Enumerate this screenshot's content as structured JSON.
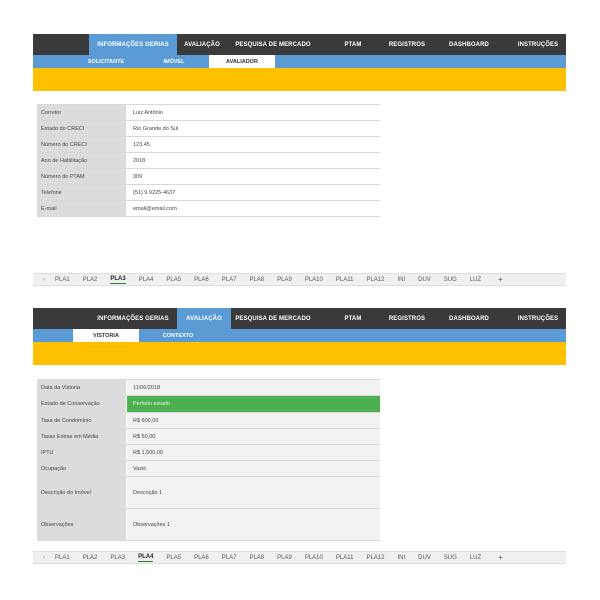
{
  "panel1": {
    "nav_tabs": [
      "INFORMAÇÕES GERIAS",
      "AVALIAÇÃO",
      "PESQUISA DE MERCADO",
      "PTAM",
      "REGISTROS",
      "DASHBOARD",
      "INSTRUÇÕES"
    ],
    "active_nav": 0,
    "sub_tabs": [
      "SOLICITANTE",
      "IMÓVEL",
      "AVALIADOR"
    ],
    "active_sub": 2,
    "rows": [
      {
        "label": "Corretor",
        "value": "Luiz Antônio"
      },
      {
        "label": "Estado do CRECI",
        "value": "Rio Grande do Sul"
      },
      {
        "label": "Número do CRECI",
        "value": "123.45"
      },
      {
        "label": "Ano de Habilitação",
        "value": "2018"
      },
      {
        "label": "Número do PTAM",
        "value": "309"
      },
      {
        "label": "Telefone",
        "value": "(51) 9 9225-4637"
      },
      {
        "label": "E-mail",
        "value": "email@email.com"
      }
    ]
  },
  "panel2": {
    "nav_tabs": [
      "INFORMAÇÕES GERIAS",
      "AVALIAÇÃO",
      "PESQUISA DE MERCADO",
      "PTAM",
      "REGISTROS",
      "DASHBOARD",
      "INSTRUÇÕES"
    ],
    "active_nav": 1,
    "sub_tabs": [
      "VISTORIA",
      "CONTEXTO"
    ],
    "active_sub": 0,
    "rows": [
      {
        "label": "Data da Vistoria",
        "value": "11/06/2018"
      },
      {
        "label": "Estado de Conservação",
        "value": "Perfeito estado"
      },
      {
        "label": "Taxa de Condomínio",
        "value": "R$ 600,00"
      },
      {
        "label": "Taxas Extras em Média",
        "value": "R$ 50,00"
      },
      {
        "label": "IPTU",
        "value": "R$ 1.500,00"
      },
      {
        "label": "Ocupação",
        "value": "Vazio"
      },
      {
        "label": "Descrição do Imóvel",
        "value": "Descrição 1"
      },
      {
        "label": "Observações",
        "value": "Observações 1"
      }
    ]
  },
  "sheets1": {
    "prev_arrow": "‹",
    "tabs": [
      "PLA1",
      "PLA2",
      "PLA3",
      "PLA4",
      "PLA5",
      "PLA6",
      "PLA7",
      "PLA8",
      "PLA9",
      "PLA10",
      "PLA11",
      "PLA12",
      "INI",
      "DUV",
      "SUG",
      "LUZ"
    ],
    "active": 2,
    "add": "+"
  },
  "sheets2": {
    "prev_arrow": "‹",
    "tabs": [
      "PLA1",
      "PLA2",
      "PLA3",
      "PLA4",
      "PLA5",
      "PLA6",
      "PLA7",
      "PLA8",
      "PLA9",
      "PLA10",
      "PLA11",
      "PLA12",
      "INI",
      "DUV",
      "SUG",
      "LUZ"
    ],
    "active": 3,
    "add": "+"
  },
  "colors": {
    "navbar": "#3a3a3a",
    "accent_blue": "#5b9bd5",
    "yellow_band": "#ffc000",
    "status_green": "#4caf50"
  }
}
